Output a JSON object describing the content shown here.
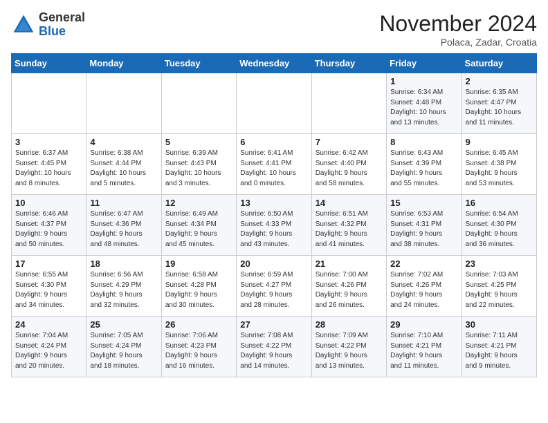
{
  "logo": {
    "general": "General",
    "blue": "Blue"
  },
  "header": {
    "month": "November 2024",
    "location": "Polaca, Zadar, Croatia"
  },
  "days_of_week": [
    "Sunday",
    "Monday",
    "Tuesday",
    "Wednesday",
    "Thursday",
    "Friday",
    "Saturday"
  ],
  "weeks": [
    [
      {
        "day": "",
        "info": ""
      },
      {
        "day": "",
        "info": ""
      },
      {
        "day": "",
        "info": ""
      },
      {
        "day": "",
        "info": ""
      },
      {
        "day": "",
        "info": ""
      },
      {
        "day": "1",
        "info": "Sunrise: 6:34 AM\nSunset: 4:48 PM\nDaylight: 10 hours\nand 13 minutes."
      },
      {
        "day": "2",
        "info": "Sunrise: 6:35 AM\nSunset: 4:47 PM\nDaylight: 10 hours\nand 11 minutes."
      }
    ],
    [
      {
        "day": "3",
        "info": "Sunrise: 6:37 AM\nSunset: 4:45 PM\nDaylight: 10 hours\nand 8 minutes."
      },
      {
        "day": "4",
        "info": "Sunrise: 6:38 AM\nSunset: 4:44 PM\nDaylight: 10 hours\nand 5 minutes."
      },
      {
        "day": "5",
        "info": "Sunrise: 6:39 AM\nSunset: 4:43 PM\nDaylight: 10 hours\nand 3 minutes."
      },
      {
        "day": "6",
        "info": "Sunrise: 6:41 AM\nSunset: 4:41 PM\nDaylight: 10 hours\nand 0 minutes."
      },
      {
        "day": "7",
        "info": "Sunrise: 6:42 AM\nSunset: 4:40 PM\nDaylight: 9 hours\nand 58 minutes."
      },
      {
        "day": "8",
        "info": "Sunrise: 6:43 AM\nSunset: 4:39 PM\nDaylight: 9 hours\nand 55 minutes."
      },
      {
        "day": "9",
        "info": "Sunrise: 6:45 AM\nSunset: 4:38 PM\nDaylight: 9 hours\nand 53 minutes."
      }
    ],
    [
      {
        "day": "10",
        "info": "Sunrise: 6:46 AM\nSunset: 4:37 PM\nDaylight: 9 hours\nand 50 minutes."
      },
      {
        "day": "11",
        "info": "Sunrise: 6:47 AM\nSunset: 4:36 PM\nDaylight: 9 hours\nand 48 minutes."
      },
      {
        "day": "12",
        "info": "Sunrise: 6:49 AM\nSunset: 4:34 PM\nDaylight: 9 hours\nand 45 minutes."
      },
      {
        "day": "13",
        "info": "Sunrise: 6:50 AM\nSunset: 4:33 PM\nDaylight: 9 hours\nand 43 minutes."
      },
      {
        "day": "14",
        "info": "Sunrise: 6:51 AM\nSunset: 4:32 PM\nDaylight: 9 hours\nand 41 minutes."
      },
      {
        "day": "15",
        "info": "Sunrise: 6:53 AM\nSunset: 4:31 PM\nDaylight: 9 hours\nand 38 minutes."
      },
      {
        "day": "16",
        "info": "Sunrise: 6:54 AM\nSunset: 4:30 PM\nDaylight: 9 hours\nand 36 minutes."
      }
    ],
    [
      {
        "day": "17",
        "info": "Sunrise: 6:55 AM\nSunset: 4:30 PM\nDaylight: 9 hours\nand 34 minutes."
      },
      {
        "day": "18",
        "info": "Sunrise: 6:56 AM\nSunset: 4:29 PM\nDaylight: 9 hours\nand 32 minutes."
      },
      {
        "day": "19",
        "info": "Sunrise: 6:58 AM\nSunset: 4:28 PM\nDaylight: 9 hours\nand 30 minutes."
      },
      {
        "day": "20",
        "info": "Sunrise: 6:59 AM\nSunset: 4:27 PM\nDaylight: 9 hours\nand 28 minutes."
      },
      {
        "day": "21",
        "info": "Sunrise: 7:00 AM\nSunset: 4:26 PM\nDaylight: 9 hours\nand 26 minutes."
      },
      {
        "day": "22",
        "info": "Sunrise: 7:02 AM\nSunset: 4:26 PM\nDaylight: 9 hours\nand 24 minutes."
      },
      {
        "day": "23",
        "info": "Sunrise: 7:03 AM\nSunset: 4:25 PM\nDaylight: 9 hours\nand 22 minutes."
      }
    ],
    [
      {
        "day": "24",
        "info": "Sunrise: 7:04 AM\nSunset: 4:24 PM\nDaylight: 9 hours\nand 20 minutes."
      },
      {
        "day": "25",
        "info": "Sunrise: 7:05 AM\nSunset: 4:24 PM\nDaylight: 9 hours\nand 18 minutes."
      },
      {
        "day": "26",
        "info": "Sunrise: 7:06 AM\nSunset: 4:23 PM\nDaylight: 9 hours\nand 16 minutes."
      },
      {
        "day": "27",
        "info": "Sunrise: 7:08 AM\nSunset: 4:22 PM\nDaylight: 9 hours\nand 14 minutes."
      },
      {
        "day": "28",
        "info": "Sunrise: 7:09 AM\nSunset: 4:22 PM\nDaylight: 9 hours\nand 13 minutes."
      },
      {
        "day": "29",
        "info": "Sunrise: 7:10 AM\nSunset: 4:21 PM\nDaylight: 9 hours\nand 11 minutes."
      },
      {
        "day": "30",
        "info": "Sunrise: 7:11 AM\nSunset: 4:21 PM\nDaylight: 9 hours\nand 9 minutes."
      }
    ]
  ]
}
